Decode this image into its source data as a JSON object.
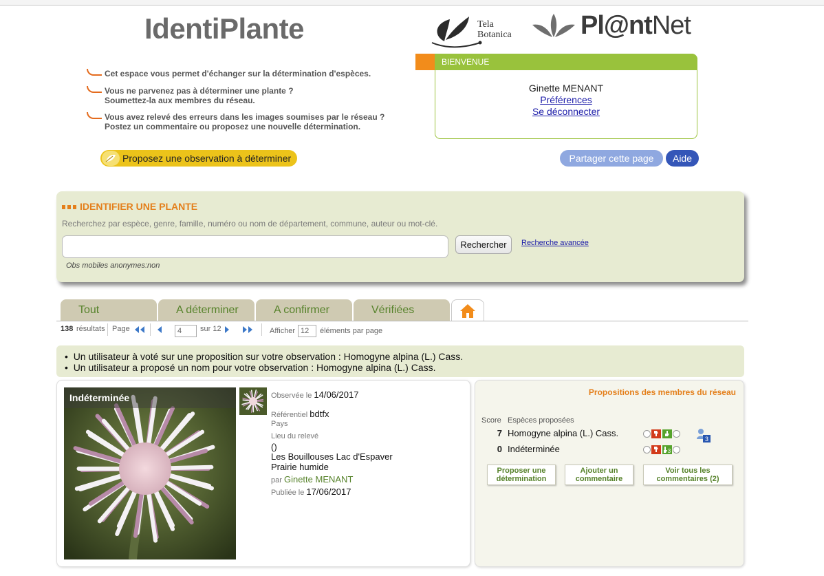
{
  "header": {
    "app_title": "IdentiPlante",
    "intro": [
      {
        "line1": "Cet espace vous permet d'échanger sur la détermination d'espèces.",
        "line2": ""
      },
      {
        "line1": "Vous ne parvenez pas à déterminer une plante ?",
        "line2": "Soumettez-la aux membres du réseau."
      },
      {
        "line1": "Vous avez relevé des erreurs dans les images soumises par le réseau ?",
        "line2": "Postez un commentaire ou proposez une nouvelle détermination."
      }
    ],
    "propose_obs_label": "Proposez une observation à déterminer",
    "tela_logo_line1": "Tela",
    "tela_logo_line2": "Botanica",
    "plantnet_part1": "Pl@nt",
    "plantnet_part2": "Net",
    "share_label": "Partager cette page",
    "help_label": "Aide"
  },
  "welcome": {
    "heading": "BIENVENUE",
    "user": "Ginette MENANT",
    "preferences": "Préférences",
    "logout": "Se déconnecter"
  },
  "search": {
    "title": "IDENTIFIER UNE PLANTE",
    "hint": "Recherchez par espèce, genre, famille, numéro ou nom de département, commune, auteur ou mot-clé.",
    "query": "",
    "button": "Rechercher",
    "advanced": "Recherche avancée",
    "mobile_note": "Obs mobiles anonymes:non"
  },
  "tabs": [
    {
      "label": "Tout"
    },
    {
      "label": "A déterminer"
    },
    {
      "label": "A confirmer"
    },
    {
      "label": "Vérifiées"
    }
  ],
  "pager": {
    "count": "138",
    "results_label": "résultats",
    "page_label": "Page",
    "current_page": "4",
    "total_label": "sur 12",
    "show_label": "Afficher",
    "per_page": "12",
    "per_page_suffix": "éléments par page"
  },
  "notifications": [
    "Un utilisateur à voté sur une proposition sur votre observation : Homogyne alpina (L.) Cass.",
    "Un utilisateur a proposé un nom pour votre observation : Homogyne alpina (L.) Cass."
  ],
  "observation": {
    "status": "Indéterminée",
    "observed_label": "Observée le",
    "observed_date": "14/06/2017",
    "referential_label": "Référentiel",
    "referential": "bdtfx",
    "country_label": "Pays",
    "place_label": "Lieu du relevé",
    "place_line1": "()",
    "place_line2": "Les Bouillouses Lac d'Espaver",
    "place_line3": "Prairie humide",
    "author_label": "par",
    "author": "Ginette MENANT",
    "published_label": "Publiée le",
    "published_date": "17/06/2017"
  },
  "proposals": {
    "title": "Propositions des membres du réseau",
    "score_header": "Score",
    "species_header": "Espèces proposées",
    "rows": [
      {
        "score": "7",
        "species": "Homogyne alpina (L.) Cass.",
        "yes_votes": "",
        "voters": "3"
      },
      {
        "score": "0",
        "species": "Indéterminée",
        "yes_votes": "3",
        "voters": ""
      }
    ],
    "buttons": {
      "propose": "Proposer une détermination",
      "comment": "Ajouter un commentaire",
      "see_all": "Voir tous les commentaires (2)"
    }
  },
  "colors": {
    "accent_orange": "#e47f1b",
    "accent_green": "#99c23c",
    "panel_bg": "#e7ebd2",
    "tab_bg": "#cfcab2",
    "propose_yellow": "#ecc31a"
  }
}
